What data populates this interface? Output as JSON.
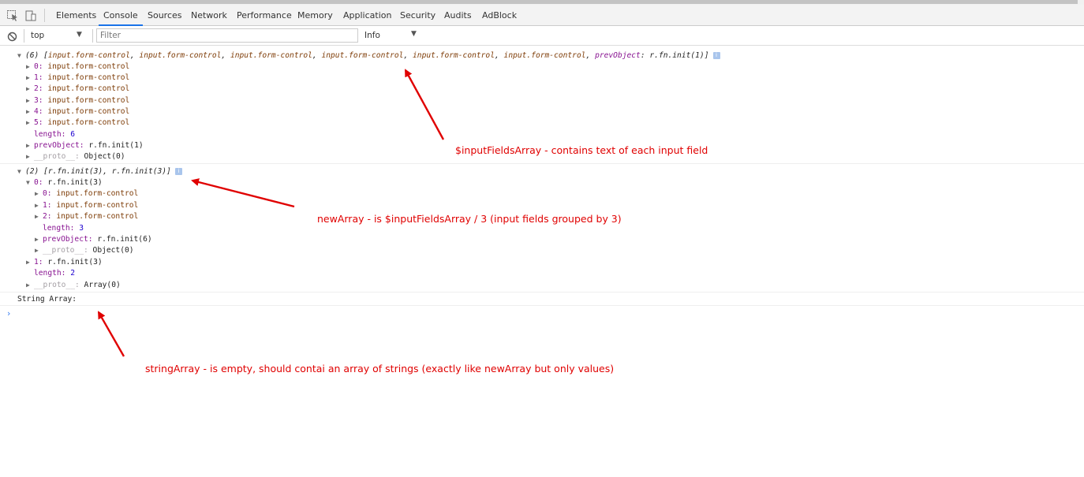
{
  "tabs": [
    "Elements",
    "Console",
    "Sources",
    "Network",
    "Performance",
    "Memory",
    "Application",
    "Security",
    "Audits",
    "AdBlock"
  ],
  "active_tab": "Console",
  "toolbar": {
    "context": "top",
    "filter_placeholder": "Filter",
    "level": "Info"
  },
  "log1": {
    "prefix": "(6) [",
    "items": [
      "input.form-control",
      "input.form-control",
      "input.form-control",
      "input.form-control",
      "input.form-control",
      "input.form-control"
    ],
    "sep": ", ",
    "prevkey": "prevObject",
    "prevval": " r.fn.init(1)]",
    "entries": [
      {
        "key": "0",
        "val": "input.form-control"
      },
      {
        "key": "1",
        "val": "input.form-control"
      },
      {
        "key": "2",
        "val": "input.form-control"
      },
      {
        "key": "3",
        "val": "input.form-control"
      },
      {
        "key": "4",
        "val": "input.form-control"
      },
      {
        "key": "5",
        "val": "input.form-control"
      }
    ],
    "length_key": "length",
    "length_val": "6",
    "prev_key": "prevObject",
    "prev_val": "r.fn.init(1)",
    "proto_key": "__proto__",
    "proto_val": "Object(0)"
  },
  "log2": {
    "summary": "(2) [r.fn.init(3), r.fn.init(3)]",
    "item0_key": "0",
    "item0_val": "r.fn.init(3)",
    "sub": [
      {
        "key": "0",
        "val": "input.form-control"
      },
      {
        "key": "1",
        "val": "input.form-control"
      },
      {
        "key": "2",
        "val": "input.form-control"
      }
    ],
    "sub_length_key": "length",
    "sub_length_val": "3",
    "sub_prev_key": "prevObject",
    "sub_prev_val": "r.fn.init(6)",
    "sub_proto_key": "__proto__",
    "sub_proto_val": "Object(0)",
    "item1_key": "1",
    "item1_val": "r.fn.init(3)",
    "length_key": "length",
    "length_val": "2",
    "proto_key": "__proto__",
    "proto_val": "Array(0)"
  },
  "log3": {
    "text": "String Array:"
  },
  "annotations": {
    "a1": "$inputFieldsArray - contains text of each input field",
    "a2": "newArray - is $inputFieldsArray / 3 (input fields grouped by 3)",
    "a3": "stringArray - is empty, should contai an array of strings (exactly like newArray but only values)"
  },
  "colors": {
    "accent": "#1a73e8",
    "annotation": "#e00000",
    "key": "#881391",
    "node": "#7e3c07",
    "number": "#1c00cf"
  }
}
